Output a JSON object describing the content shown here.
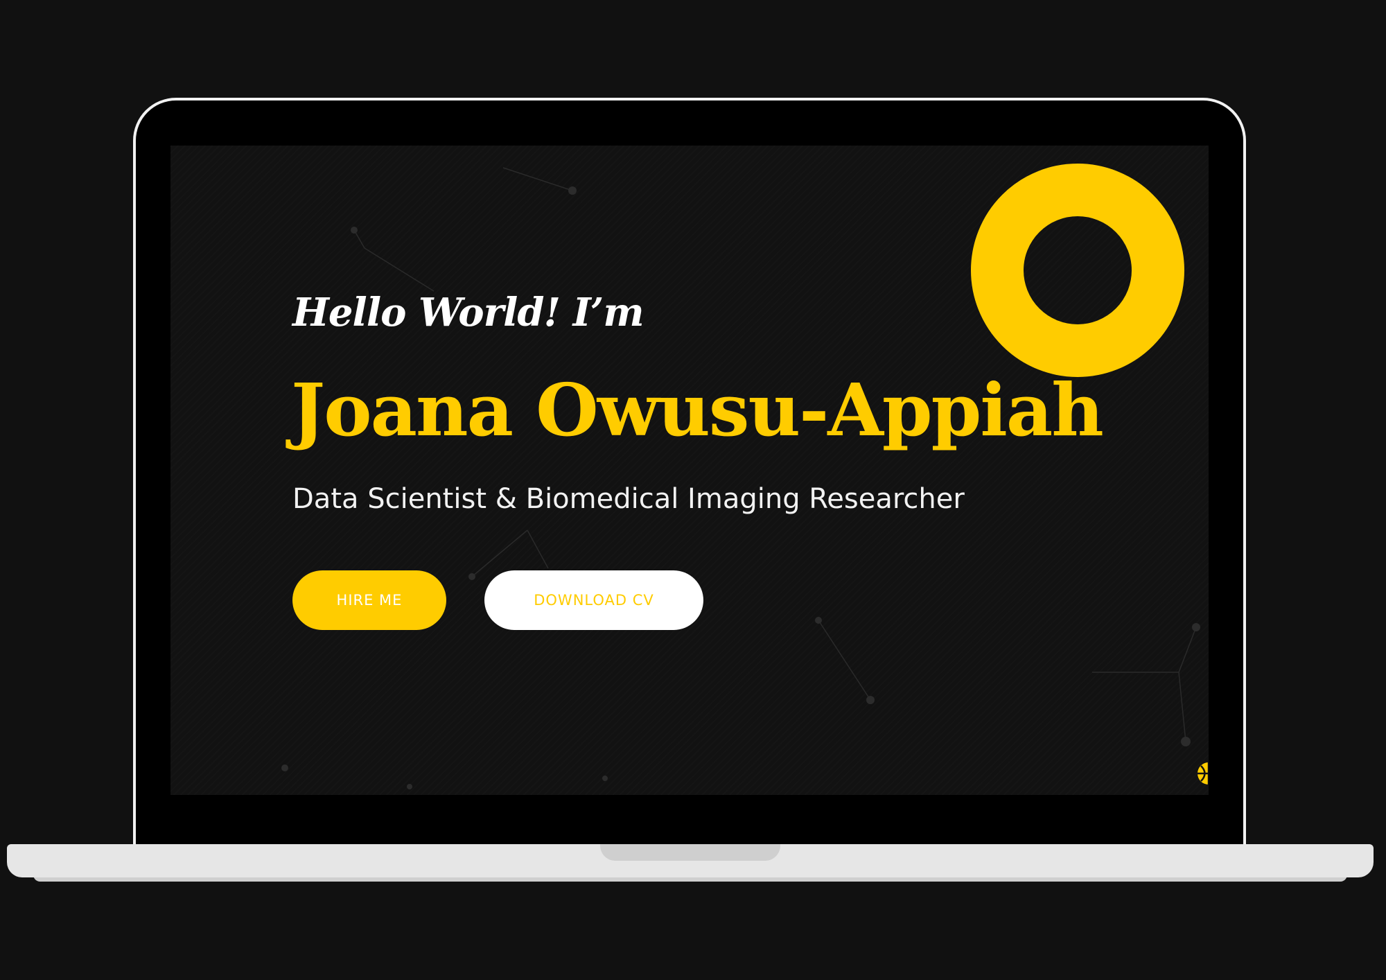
{
  "hero": {
    "greeting": "Hello World! I’m",
    "name": "Joana Owusu-Appiah",
    "role": "Data Scientist & Biomedical Imaging Researcher"
  },
  "buttons": {
    "hire_label": "HIRE ME",
    "cv_label": "DOWNLOAD CV"
  },
  "colors": {
    "accent": "#ffcc00",
    "background": "#111111",
    "text": "#ffffff"
  },
  "icons": {
    "decor_ring": "ring-decoration-icon",
    "corner": "ball-icon"
  }
}
